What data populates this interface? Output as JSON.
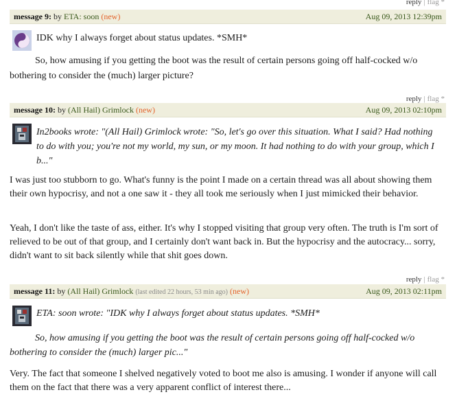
{
  "messages": [
    {
      "label": "message 9:",
      "by": "by",
      "author": "ETA: soon",
      "new": "(new)",
      "date": "Aug 09, 2013 12:39pm",
      "actions": {
        "reply": "reply",
        "flag": "flag *"
      },
      "first_line": "IDK why I always forget about status updates. *SMH*",
      "para1": "So, how amusing if you getting the boot was the result of certain persons going off half-cocked w/o bothering to consider the (much) larger picture?"
    },
    {
      "label": "message 10:",
      "by": "by",
      "author": "(All Hail) Grimlock",
      "new": "(new)",
      "date": "Aug 09, 2013 02:10pm",
      "actions": {
        "reply": "reply",
        "flag": "flag *"
      },
      "quote": "In2books wrote: \"(All Hail) Grimlock wrote: \"So, let's go over this situation. What I said? Had nothing to do with you; you're not my world, my sun, or my moon. It had nothing to do with your group, which I b...\"",
      "para1": "I was just too stubborn to go. What's funny is the point I made on a certain thread was all about showing them their own hypocrisy, and not a one saw it - they all took me seriously when I just mimicked their behavior.",
      "para2": "Yeah, I don't like the taste of ass, either. It's why I stopped visiting that group very often. The truth is I'm sort of relieved to be out of that group, and I certainly don't want back in. But the hypocrisy and the autocracy... sorry, didn't want to sit back silently while that shit goes down."
    },
    {
      "label": "message 11:",
      "by": "by",
      "author": "(All Hail) Grimlock",
      "edited": "(last edited 22 hours, 53 min ago)",
      "new": "(new)",
      "date": "Aug 09, 2013 02:11pm",
      "actions": {
        "reply": "reply",
        "flag": "flag *"
      },
      "quote1": "ETA: soon wrote: \"IDK why I always forget about status updates. *SMH*",
      "quote2": "So, how amusing if you getting the boot was the result of certain persons going off half-cocked w/o bothering to consider the (much) larger pic...\"",
      "para1": "Very. The fact that someone I shelved negatively voted to boot me also is amusing. I wonder if anyone will call them on the fact that there was a very apparent conflict of interest there..."
    }
  ],
  "top_actions": {
    "reply": "reply",
    "flag": "flag *"
  }
}
